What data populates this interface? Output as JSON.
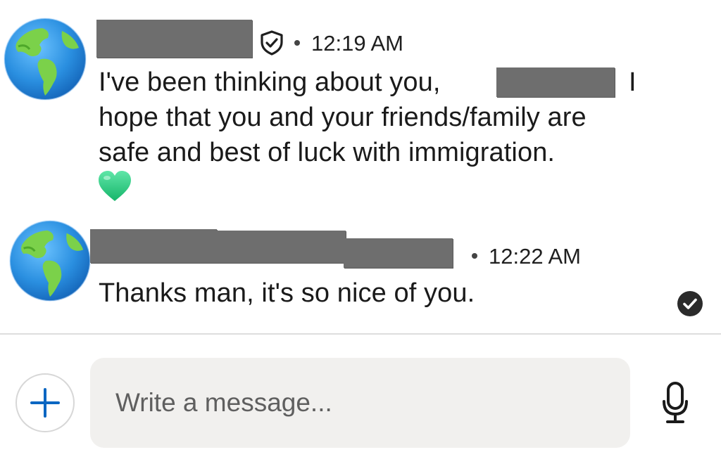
{
  "messages": [
    {
      "timestamp": "12:19 AM",
      "text_line1_a": "I've been thinking about you,",
      "text_line1_b": "I",
      "text_line2": "hope that you and your friends/family are",
      "text_line3": "safe and best of luck with immigration.",
      "reaction_icon": "green-heart-icon",
      "sender_badge_icon": "shield-check-icon"
    },
    {
      "timestamp": "12:22 AM",
      "text": "Thanks man, it's so nice of you.",
      "read_receipt_icon": "read-check-icon"
    }
  ],
  "composer": {
    "placeholder": "Write a message...",
    "attach_icon": "plus-icon",
    "voice_icon": "microphone-icon"
  },
  "colors": {
    "accent": "#0a66c2",
    "redaction": "#6e6e6e",
    "heart": "#2ed38a",
    "composer_bg": "#f1f0ee",
    "divider": "#dedede"
  }
}
